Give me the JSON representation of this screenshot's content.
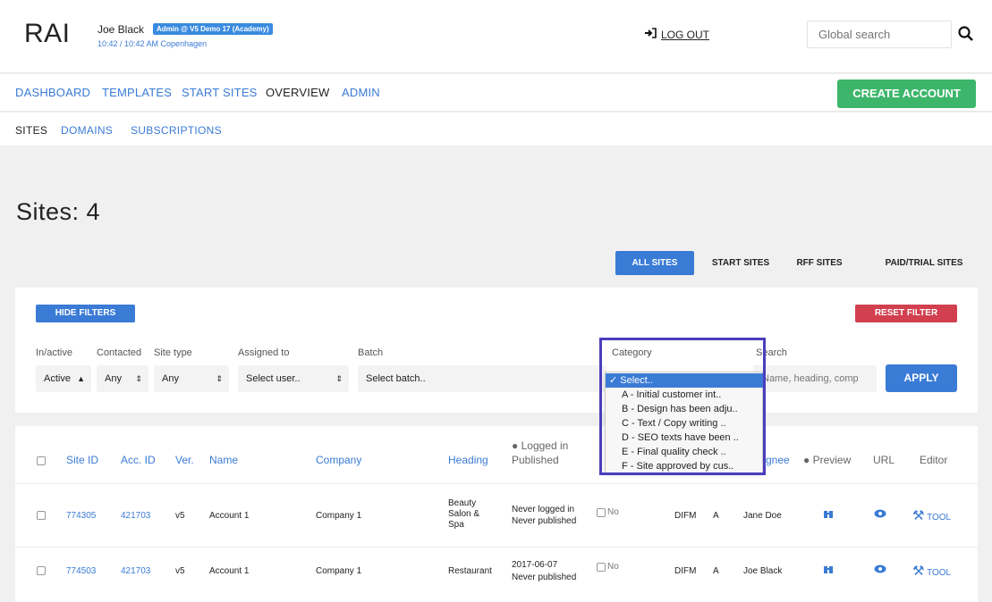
{
  "header": {
    "logo": "RAI",
    "user_name": "Joe Black",
    "role_badge": "Admin @ V5 Demo 17 (Academy)",
    "time": "10:42 / 10:42 AM Copenhagen",
    "logout": "LOG OUT",
    "search_placeholder": "Global search"
  },
  "mainnav": {
    "items": [
      "DASHBOARD",
      "TEMPLATES",
      "START SITES",
      "OVERVIEW",
      "ADMIN"
    ],
    "active": "OVERVIEW",
    "create_account": "CREATE ACCOUNT"
  },
  "subnav": {
    "items": [
      "SITES",
      "DOMAINS",
      "SUBSCRIPTIONS"
    ],
    "active": "SITES"
  },
  "page": {
    "title": "Sites: 4"
  },
  "site_tabs": [
    "ALL SITES",
    "START SITES",
    "RFF SITES",
    "PAID/TRIAL SITES"
  ],
  "filters": {
    "hide_filters": "HIDE FILTERS",
    "reset_filter": "RESET FILTER",
    "labels": {
      "inactive": "In/active",
      "contacted": "Contacted",
      "site_type": "Site type",
      "assigned_to": "Assigned to",
      "batch": "Batch",
      "category": "Category",
      "search": "Search"
    },
    "values": {
      "inactive": "Active",
      "contacted": "Any",
      "site_type": "Any",
      "assigned_to": "Select user..",
      "batch": "Select batch.."
    },
    "search_placeholder": "Name, heading, comp",
    "apply": "APPLY",
    "category_options": [
      "✓ Select..",
      "A - Initial customer int..",
      "B - Design has been adju..",
      "C - Text / Copy writing ..",
      "D - SEO texts have been ..",
      "E - Final quality check ..",
      "F - Site approved by cus.."
    ]
  },
  "table": {
    "headers": {
      "site_id": "Site ID",
      "acc_id": "Acc. ID",
      "ver": "Ver.",
      "name": "Name",
      "company": "Company",
      "heading": "Heading",
      "logged_in": "Logged in",
      "published": "Published",
      "assignee": "gnee",
      "preview": "Preview",
      "url": "URL",
      "editor": "Editor"
    },
    "rows": [
      {
        "site_id": "774305",
        "acc_id": "421703",
        "ver": "v5",
        "name": "Account 1",
        "company": "Company 1",
        "heading": "Beauty Salon & Spa",
        "logged": "Never logged in",
        "published": "Never published",
        "contacted": "No",
        "type": "DIFM",
        "cat": "A",
        "assignee": "Jane Doe",
        "tool": "TOOL"
      },
      {
        "site_id": "774503",
        "acc_id": "421703",
        "ver": "v5",
        "name": "Account 1",
        "company": "Company 1",
        "heading": "Restaurant",
        "logged": "2017-06-07",
        "published": "Never published",
        "contacted": "No",
        "type": "DIFM",
        "cat": "A",
        "assignee": "Joe Black",
        "tool": "TOOL"
      }
    ]
  }
}
